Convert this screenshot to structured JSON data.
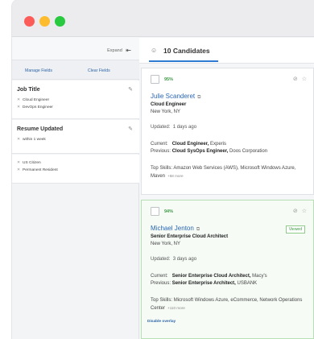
{
  "sidebar": {
    "expand_label": "Expand",
    "manage_fields": "Manage Fields",
    "clear_fields": "Clear Fields",
    "filters": [
      {
        "title": "Job Title",
        "chips": [
          "Cloud Engineer",
          "DevOps Engineer"
        ]
      },
      {
        "title": "Resume Updated",
        "chips": [
          "within 1 week"
        ]
      },
      {
        "title": "",
        "chips": [
          "US Citizen",
          "Permanent Resident"
        ]
      }
    ]
  },
  "header": {
    "title": "10 Candidates"
  },
  "cards": [
    {
      "match": "95%",
      "name": "Julie Scanderet",
      "role": "Cloud Engineer",
      "location": "New York, NY",
      "updated_label": "Updated:",
      "updated_value": "1 days ago",
      "current_label": "Current:",
      "current_role": "Cloud Engineer,",
      "current_company": "Experis",
      "previous_label": "Previous:",
      "previous_role": "Cloud SysOps Engineer,",
      "previous_company": "Doos Corporation",
      "skills_label": "Top Skills:",
      "skills": "Amazon Web Services (AWS), Microsoft Windows Azure, Maven",
      "more": "+58 more"
    },
    {
      "match": "94%",
      "name": "Michael Jenton",
      "role": "Senior Enterprise Cloud Architect",
      "location": "New York, NY",
      "viewed": "Viewed",
      "updated_label": "Updated:",
      "updated_value": "3 days ago",
      "current_label": "Current:",
      "current_role": "Senior Enterprise Cloud Architect,",
      "current_company": "Macy's",
      "previous_label": "Previous:",
      "previous_role": "Senior Enterprise Architect,",
      "previous_company": "USBANK",
      "skills_label": "Top Skills:",
      "skills": "Microsoft Windows Azure, eCommerce, Network Operations Center",
      "more": "+110 more",
      "disable_overlay": "Disable overlay"
    }
  ]
}
